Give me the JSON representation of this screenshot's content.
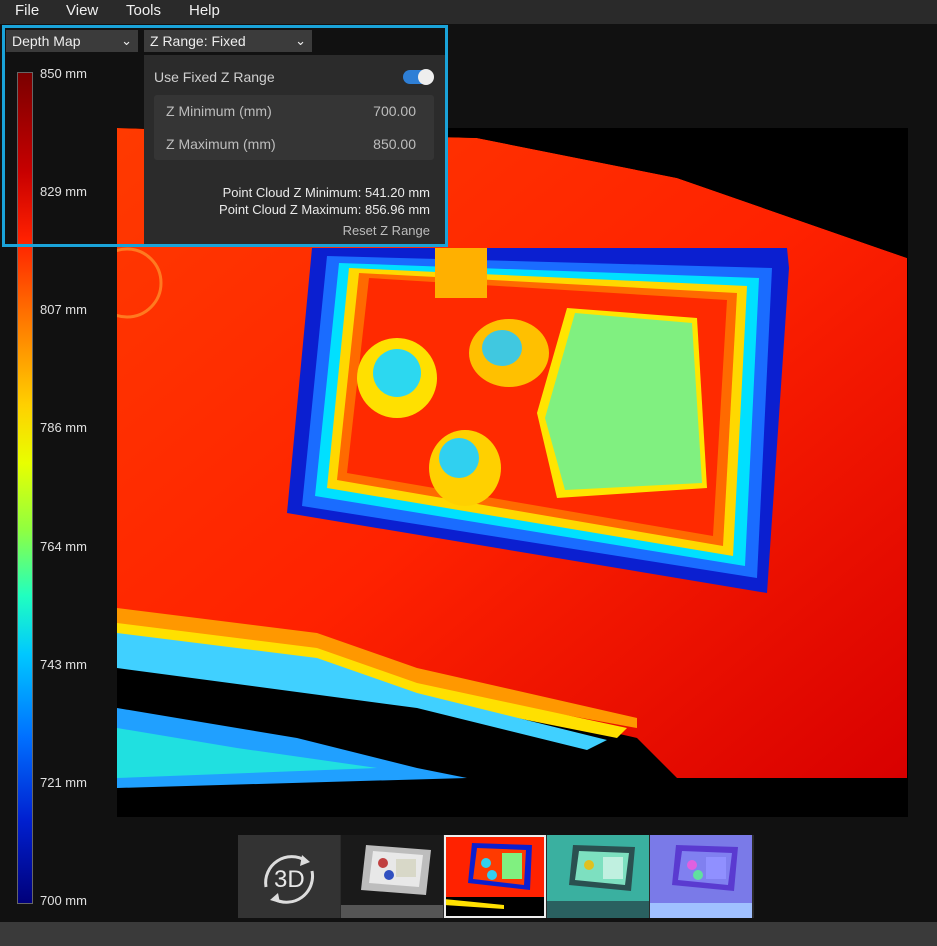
{
  "menu": [
    "File",
    "View",
    "Tools",
    "Help"
  ],
  "view_mode": {
    "selected": "Depth Map",
    "chevron_icon": "chevron-down-icon"
  },
  "z_range_mode": {
    "selected": "Z Range: Fixed",
    "chevron_icon": "chevron-down-icon"
  },
  "colorbar": {
    "ticks": [
      "850 mm",
      "829 mm",
      "807 mm",
      "786 mm",
      "764 mm",
      "743 mm",
      "721 mm",
      "700 mm"
    ],
    "range_mm": [
      700,
      850
    ]
  },
  "z_range_panel": {
    "use_fixed_label": "Use Fixed Z Range",
    "use_fixed_enabled": true,
    "z_min_label": "Z Minimum (mm)",
    "z_min_value": "700.00",
    "z_max_label": "Z Maximum (mm)",
    "z_max_value": "850.00",
    "pc_min_text": "Point Cloud Z Minimum: 541.20 mm",
    "pc_max_text": "Point Cloud Z Maximum: 856.96 mm",
    "reset_label": "Reset Z Range"
  },
  "thumbnails": {
    "view3d_label": "3D",
    "items": [
      "rgb",
      "depth",
      "snr",
      "normals"
    ],
    "selected": "depth"
  },
  "accent_color": "#1aa3d9"
}
